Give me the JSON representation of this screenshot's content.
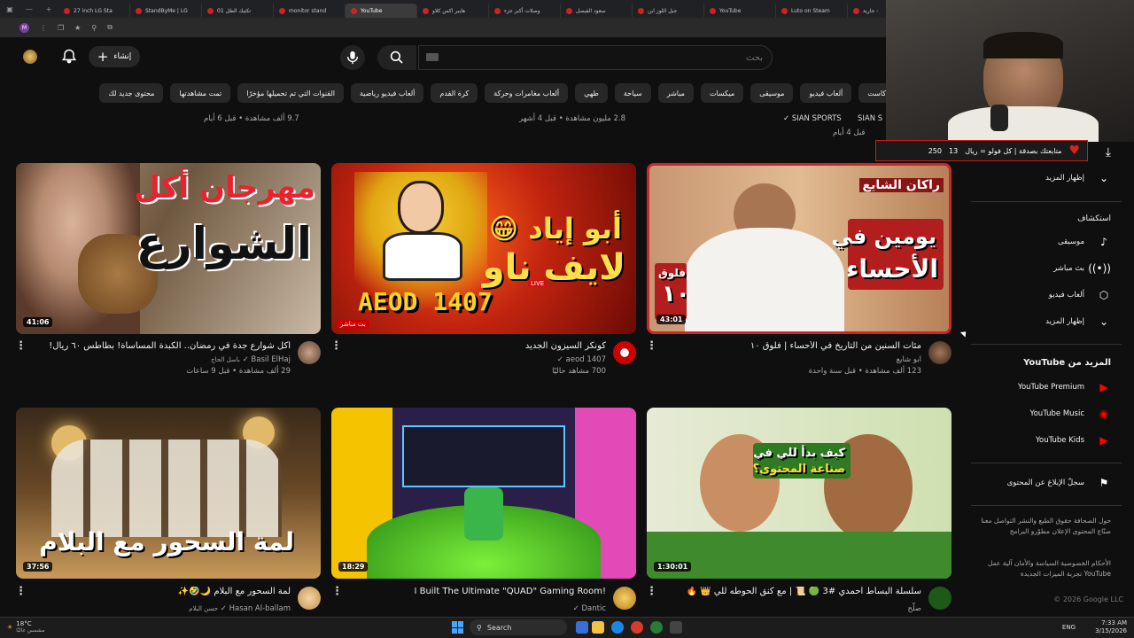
{
  "browser": {
    "tabs": [
      {
        "label": "27 inch LG Sta"
      },
      {
        "label": "StandByMe | LG"
      },
      {
        "label": "01 تكتيك الظل"
      },
      {
        "label": "monitor stand"
      },
      {
        "label": "YouTube",
        "active": true
      },
      {
        "label": "هايبر اكس كلاو"
      },
      {
        "label": "وصلات أكبر جزء"
      },
      {
        "label": "سعود الفيصل"
      },
      {
        "label": "جبل اللوز ابن"
      },
      {
        "label": "YouTube"
      },
      {
        "label": "Luto on Steam"
      },
      {
        "label": "جارية -"
      }
    ],
    "profile_initial": "M"
  },
  "header": {
    "create_label": "إنشاء",
    "search_placeholder": "بحث"
  },
  "chips": [
    "بودكاست",
    "ألعاب فيديو",
    "موسيقى",
    "ميكسات",
    "مباشر",
    "سياحة",
    "طهي",
    "ألعاب مغامرات وحركة",
    "كرة القدم",
    "ألعاب فيديو رياضية",
    "القنوات التي تم تحميلها مؤخرًا",
    "تمت مشاهدتها",
    "محتوى جديد لك"
  ],
  "prev_row": {
    "col1_stats": "9.7 ألف مشاهدة • قبل 6 أيام",
    "col2_stats": "2.8 مليون مشاهدة • قبل 4 أشهر",
    "col3_channel": "SIAN SPORTS",
    "col3_channel_b": "SIAN S",
    "col3_stats": "قبل 4 أيام"
  },
  "videos": [
    {
      "thumb_line1": "مهرجان أكل",
      "thumb_line2": "الشوارع",
      "duration": "41:06",
      "title": "أكل شوارع جدة في رمضان.. الكبدة المسأسأة! بطاطس ٦٠ ريال!",
      "channel": "Basil ElHaj",
      "channel_sub": "باسل الحاج",
      "stats": "29 ألف مشاهدة • قبل 9 ساعات"
    },
    {
      "thumb_line1": "أبو إياد 😁",
      "thumb_line2": "لايف ناو",
      "thumb_logo": "AEOD 1407",
      "thumb_live": "LIVE",
      "live_badge": "بث مباشر",
      "title": "كونكر السيزون الجديد",
      "channel": "aeod 1407",
      "stats": "700 مشاهد حاليًا"
    },
    {
      "thumb_line1": "يومين في",
      "thumb_line2": "الأحساء",
      "thumb_tag": "راكان الشايع",
      "thumb_vlog": "فلوق",
      "thumb_num": "١٠",
      "duration": "43:01",
      "title": "مئات السنين من التاريخ في الأحساء | فلوق ١٠",
      "channel": "ابو شايع",
      "stats": "123 ألف مشاهدة • قبل سنة واحدة"
    },
    {
      "thumb_line1": "لمة السحور مع البلام",
      "duration": "37:56",
      "title": "لمة السحور مع البلام 🌙🤣✨",
      "channel": "Hasan Al-ballam",
      "channel_sub": "حسن البلام"
    },
    {
      "duration": "18:29",
      "title": "I Built The Ultimate \"QUAD\" Gaming Room!",
      "channel": "Dantic"
    },
    {
      "thumb_line1": "كيف بدأ للي في",
      "thumb_line2": "صناعة المحتوى؟",
      "duration": "1:30:01",
      "title": "سلسلة البساط أحمدي #3 🟢 📜 | مع كنق الحوطه للي 👑 🔥",
      "channel": "صلّح"
    }
  ],
  "sidebar": {
    "show_more_1": "إظهار المزيد",
    "explore_heading": "استكشاف",
    "explore": [
      {
        "label": "موسيقى",
        "icon": "music-note-icon"
      },
      {
        "label": "بث مباشر",
        "icon": "live-icon"
      },
      {
        "label": "ألعاب فيديو",
        "icon": "gaming-icon"
      }
    ],
    "show_more_2": "إظهار المزيد",
    "more_heading": "المزيد من YouTube",
    "more": [
      {
        "label": "YouTube Premium"
      },
      {
        "label": "YouTube Music"
      },
      {
        "label": "YouTube Kids"
      }
    ],
    "report": "سجلّ الإبلاغ عن المحتوى",
    "footer1": "حول  الصحافة  حقوق الطبع والنشر  التواصل معنا  صنّاع المحتوى  الإعلان  مطوّرو البرامج",
    "footer2": "الأحكام  الخصوصية  السياسة والأمان  آلية عمل YouTube  تجربة الميزات الجديدة",
    "copyright": "© 2026 Google LLC"
  },
  "stream_overlay": {
    "text": "متابعتك بصدقة | كل فولو = ريال",
    "count_a": "13",
    "count_b": "250"
  },
  "taskbar": {
    "weather_temp": "18°C",
    "weather_desc": "مشمس غالبًا",
    "search_label": "Search",
    "lang": "ENG",
    "time": "7:33 AM",
    "date": "3/15/2026"
  },
  "colors": {
    "background": "#0f0f0f",
    "accent_red": "#ff0000",
    "chip_bg": "#272727"
  }
}
